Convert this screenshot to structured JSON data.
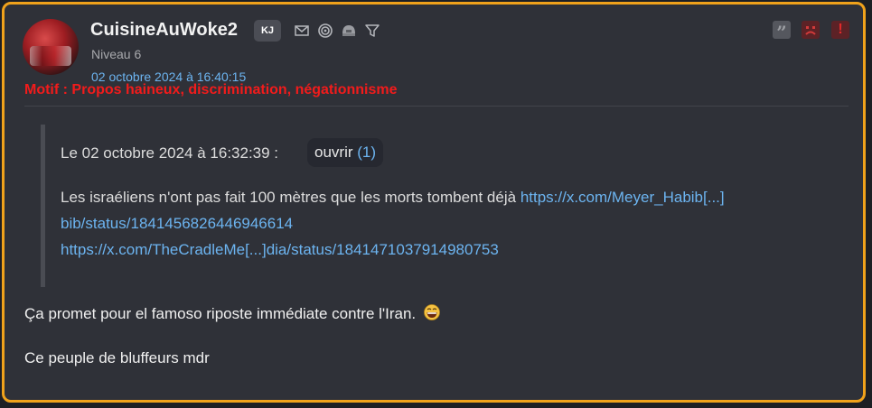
{
  "post": {
    "author": {
      "username": "CuisineAuWoke2",
      "badge": "KJ",
      "level": "Niveau 6",
      "date": "02 octobre 2024 à 16:40:15"
    },
    "moderation": {
      "motif": "Motif : Propos haineux, discrimination, négationnisme"
    },
    "header_icons": [
      "mail-icon",
      "spiral-icon",
      "helmet-icon",
      "filter-icon"
    ],
    "action_icons": [
      "quote-icon",
      "sad-face-icon",
      "alert-icon"
    ],
    "quote": {
      "meta": "Le 02 octobre 2024 à 16:32:39 :",
      "open_label": "ouvrir",
      "open_count": "(1)",
      "text": "Les israéliens n'ont pas fait 100 mètres que les morts tombent déjà",
      "link1_part1": "https://x.com/Meyer_Habib[...]",
      "link1_part2": "bib/status/1841456826446946614",
      "link2": "https://x.com/TheCradleMe[...]dia/status/1841471037914980753"
    },
    "body": {
      "line1": "Ça promet pour el famoso riposte immédiate contre l'Iran.",
      "line1_emoji": "laughing-face-icon",
      "line2": "Ce peuple de bluffeurs mdr"
    },
    "colors": {
      "border": "#f0a21b",
      "background": "#2f3138",
      "link": "#6cb4f0",
      "motif": "#f21b1b"
    }
  }
}
